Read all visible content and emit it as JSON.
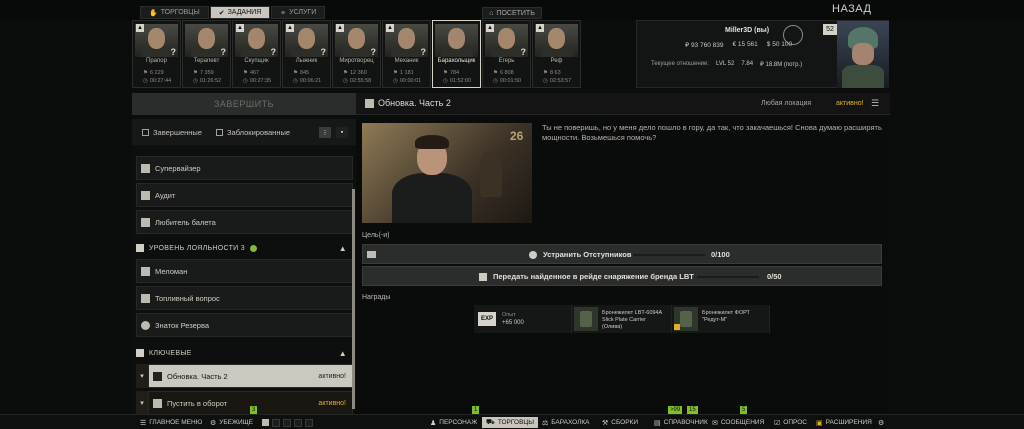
{
  "nav": {
    "tabs": [
      {
        "label": "ТОРГОВЦЫ",
        "icon": "hand-icon",
        "active": false
      },
      {
        "label": "ЗАДАНИЯ",
        "icon": "check-circle-icon",
        "active": true
      },
      {
        "label": "УСЛУГИ",
        "icon": "handshake-icon",
        "active": false
      }
    ],
    "visit_label": "ПОСЕТИТЬ",
    "back_label": "НАЗАД"
  },
  "traders": [
    {
      "name": "Прапор",
      "stat1": "6 229",
      "stat2": "00:27:44",
      "question": "?",
      "level_icon": true
    },
    {
      "name": "Терапевт",
      "stat1": "7 359",
      "stat2": "01:26:52",
      "question": "?",
      "level_icon": false
    },
    {
      "name": "Скупщик",
      "stat1": "467",
      "stat2": "00:27:35",
      "question": "?",
      "level_icon": true
    },
    {
      "name": "Лыжник",
      "stat1": "845",
      "stat2": "00:06:21",
      "question": "?",
      "level_icon": true
    },
    {
      "name": "Миротворец",
      "stat1": "12 360",
      "stat2": "02:55:58",
      "question": "?",
      "level_icon": true
    },
    {
      "name": "Механик",
      "stat1": "1 181",
      "stat2": "00:00:01",
      "question": "?",
      "level_icon": true
    },
    {
      "name": "Барахольщик",
      "stat1": "784",
      "stat2": "01:52:00",
      "question": "",
      "level_icon": false,
      "active": true
    },
    {
      "name": "Егерь",
      "stat1": "6 808",
      "stat2": "00:01:50",
      "question": "?",
      "level_icon": true
    },
    {
      "name": "Реф",
      "stat1": "8 63",
      "stat2": "02:53:57",
      "question": "",
      "level_icon": true
    }
  ],
  "player": {
    "name": "Miller3D (вы)",
    "roubles": "₽ 93 760 839",
    "euros": "€ 15 561",
    "dollars": "$ 50 100",
    "level_badge": "52",
    "standing_label": "Текущее отношение:",
    "standing_level": "LVL 52",
    "standing_rep": "7.84",
    "standing_spent": "₽ 18.8M (потр.)"
  },
  "quest_header": {
    "complete_label": "ЗАВЕРШИТЬ",
    "title": "Обновка. Часть 2",
    "location": "Любая локация",
    "status": "активно!"
  },
  "filters": {
    "completed_label": "Завершенные",
    "locked_label": "Заблокированные"
  },
  "quest_list": {
    "items_top": [
      "Супервайзер",
      "Аудит",
      "Любитель балета"
    ],
    "loyalty_group": "УРОВЕНЬ ЛОЯЛЬНОСТИ 3",
    "items_mid": [
      "Меломан",
      "Топливный вопрос",
      "Знаток Резерва"
    ],
    "key_group": "КЛЮЧЕВЫЕ",
    "selected": {
      "label": "Обновка. Часть 2",
      "status": "активно!"
    },
    "second": {
      "label": "Пустить в оборот",
      "status": "активно!"
    }
  },
  "quest": {
    "image_number": "26",
    "description": "Ты не поверишь, но у меня дело пошло в гору, да так, что закачаешься! Снова думаю расширять мощности. Возьмешься помочь?",
    "goal_label": "Цель(-и)",
    "objectives": [
      {
        "text": "Устранить Отступников",
        "progress": "0/100"
      },
      {
        "text": "Передать найденное в рейде снаряжение бренда LBT",
        "progress": "0/50"
      }
    ],
    "rewards_label": "Награды",
    "rewards": [
      {
        "type": "exp",
        "badge": "EXP",
        "line1": "Опыт",
        "line2": "+65 000"
      },
      {
        "type": "item",
        "name": "Бронежилет LBT-6094A\nSlick Plate Carrier\n(Олива)"
      },
      {
        "type": "item",
        "name": "Бронежилет ФОРТ\n\"Редут-М\"",
        "cart": true
      }
    ]
  },
  "bottom_bar": {
    "main_menu": "ГЛАВНОЕ МЕНЮ",
    "hideout": "УБЕЖИЩЕ",
    "character": "ПЕРСОНАЖ",
    "traders": "ТОРГОВЦЫ",
    "flea": "БАРАХОЛКА",
    "builds": "СБОРКИ",
    "handbook": "СПРАВОЧНИК",
    "messages": "СООБЩЕНИЯ",
    "survey": "ОПРОС",
    "extensions": "РАСШИРЕНИЯ",
    "badge_hideout": "3",
    "badge_character": "1",
    "badge_handbook_a": ">99",
    "badge_handbook_b": "15",
    "badge_messages": "5"
  },
  "colors": {
    "accent_yellow": "#e0b21f",
    "accent_green": "#7dbb3b",
    "panel_light": "#cbc9bf"
  }
}
